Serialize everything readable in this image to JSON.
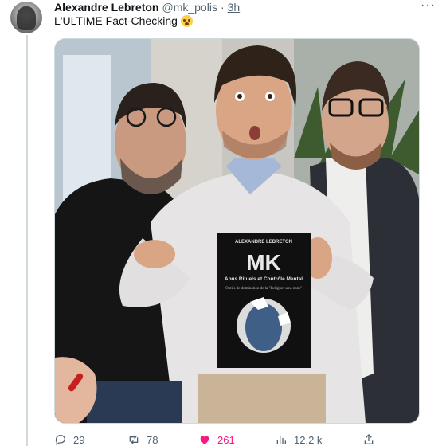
{
  "tweet": {
    "author_name": "Alexandre Lebreton",
    "author_handle": "@mk_polis",
    "separator": "·",
    "time": "3h",
    "text": "L'ULTIME Fact-Checking",
    "emoji": "shocked-face-emoji"
  },
  "book": {
    "author": "ALEXANDRE LEBRETON",
    "title": "MK",
    "subtitle": "Abus Rituels et Contrôle Mental",
    "tagline": "Outils de domination de la \"Religion sans nom\""
  },
  "stats": {
    "replies": "29",
    "retweets": "78",
    "likes": "261",
    "views": "12,2 k"
  },
  "icons": {
    "reply": "reply-icon",
    "retweet": "retweet-icon",
    "like": "heart-icon",
    "views": "views-icon",
    "share": "share-icon",
    "more": "more-icon"
  },
  "colors": {
    "like": "#f91880",
    "muted": "#536471",
    "text": "#0f1419"
  }
}
